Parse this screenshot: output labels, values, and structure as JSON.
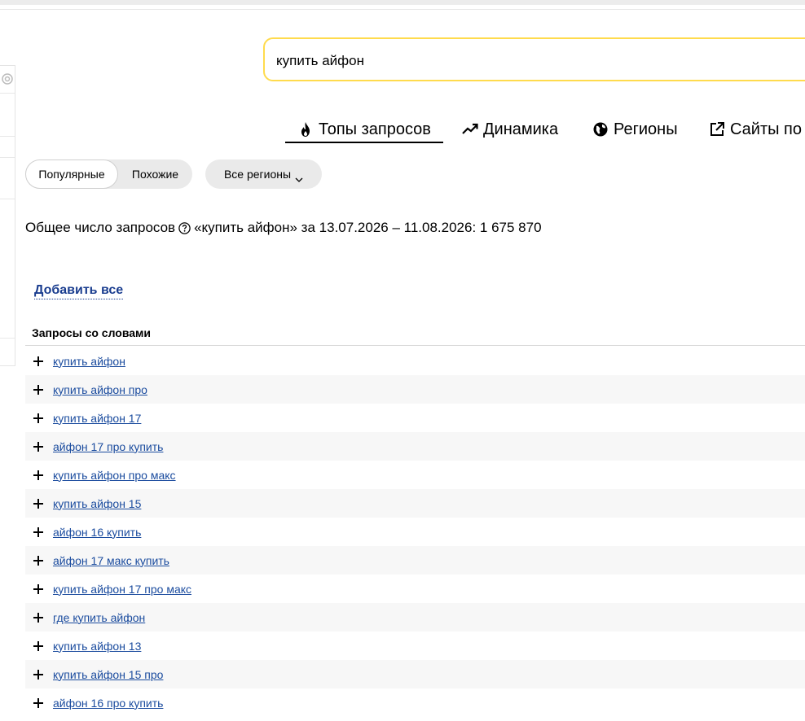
{
  "search": {
    "value": "купить айфон"
  },
  "tabs": [
    {
      "label": "Топы запросов",
      "icon": "fire-icon",
      "active": true
    },
    {
      "label": "Динамика",
      "icon": "trend-up-icon",
      "active": false
    },
    {
      "label": "Регионы",
      "icon": "globe-icon",
      "active": false
    },
    {
      "label": "Сайты по з",
      "icon": "external-link-icon",
      "active": false
    }
  ],
  "filters": {
    "popular_label": "Популярные",
    "similar_label": "Похожие",
    "regions_label": "Все регионы"
  },
  "summary": {
    "prefix": "Общее число запросов",
    "suffix": "«купить айфон» за 13.07.2026 – 11.08.2026: 1 675 870"
  },
  "add_all_label": "Добавить все",
  "table": {
    "header": "Запросы со словами",
    "rows": [
      "купить айфон",
      "купить айфон про",
      "купить айфон 17",
      "айфон 17 про купить",
      "купить айфон про макс",
      "купить айфон 15",
      "айфон 16 купить",
      "айфон 17 макс купить",
      "купить айфон 17 про макс",
      "где купить айфон",
      "купить айфон 13",
      "купить айфон 15 про",
      "айфон 16 про купить"
    ]
  },
  "colors": {
    "search_border": "#ffdb4d",
    "link": "#1a4b9e",
    "add_all": "#1a3d8f",
    "pill_bg": "#eaeaea",
    "row_alt": "#f7f7f7"
  }
}
